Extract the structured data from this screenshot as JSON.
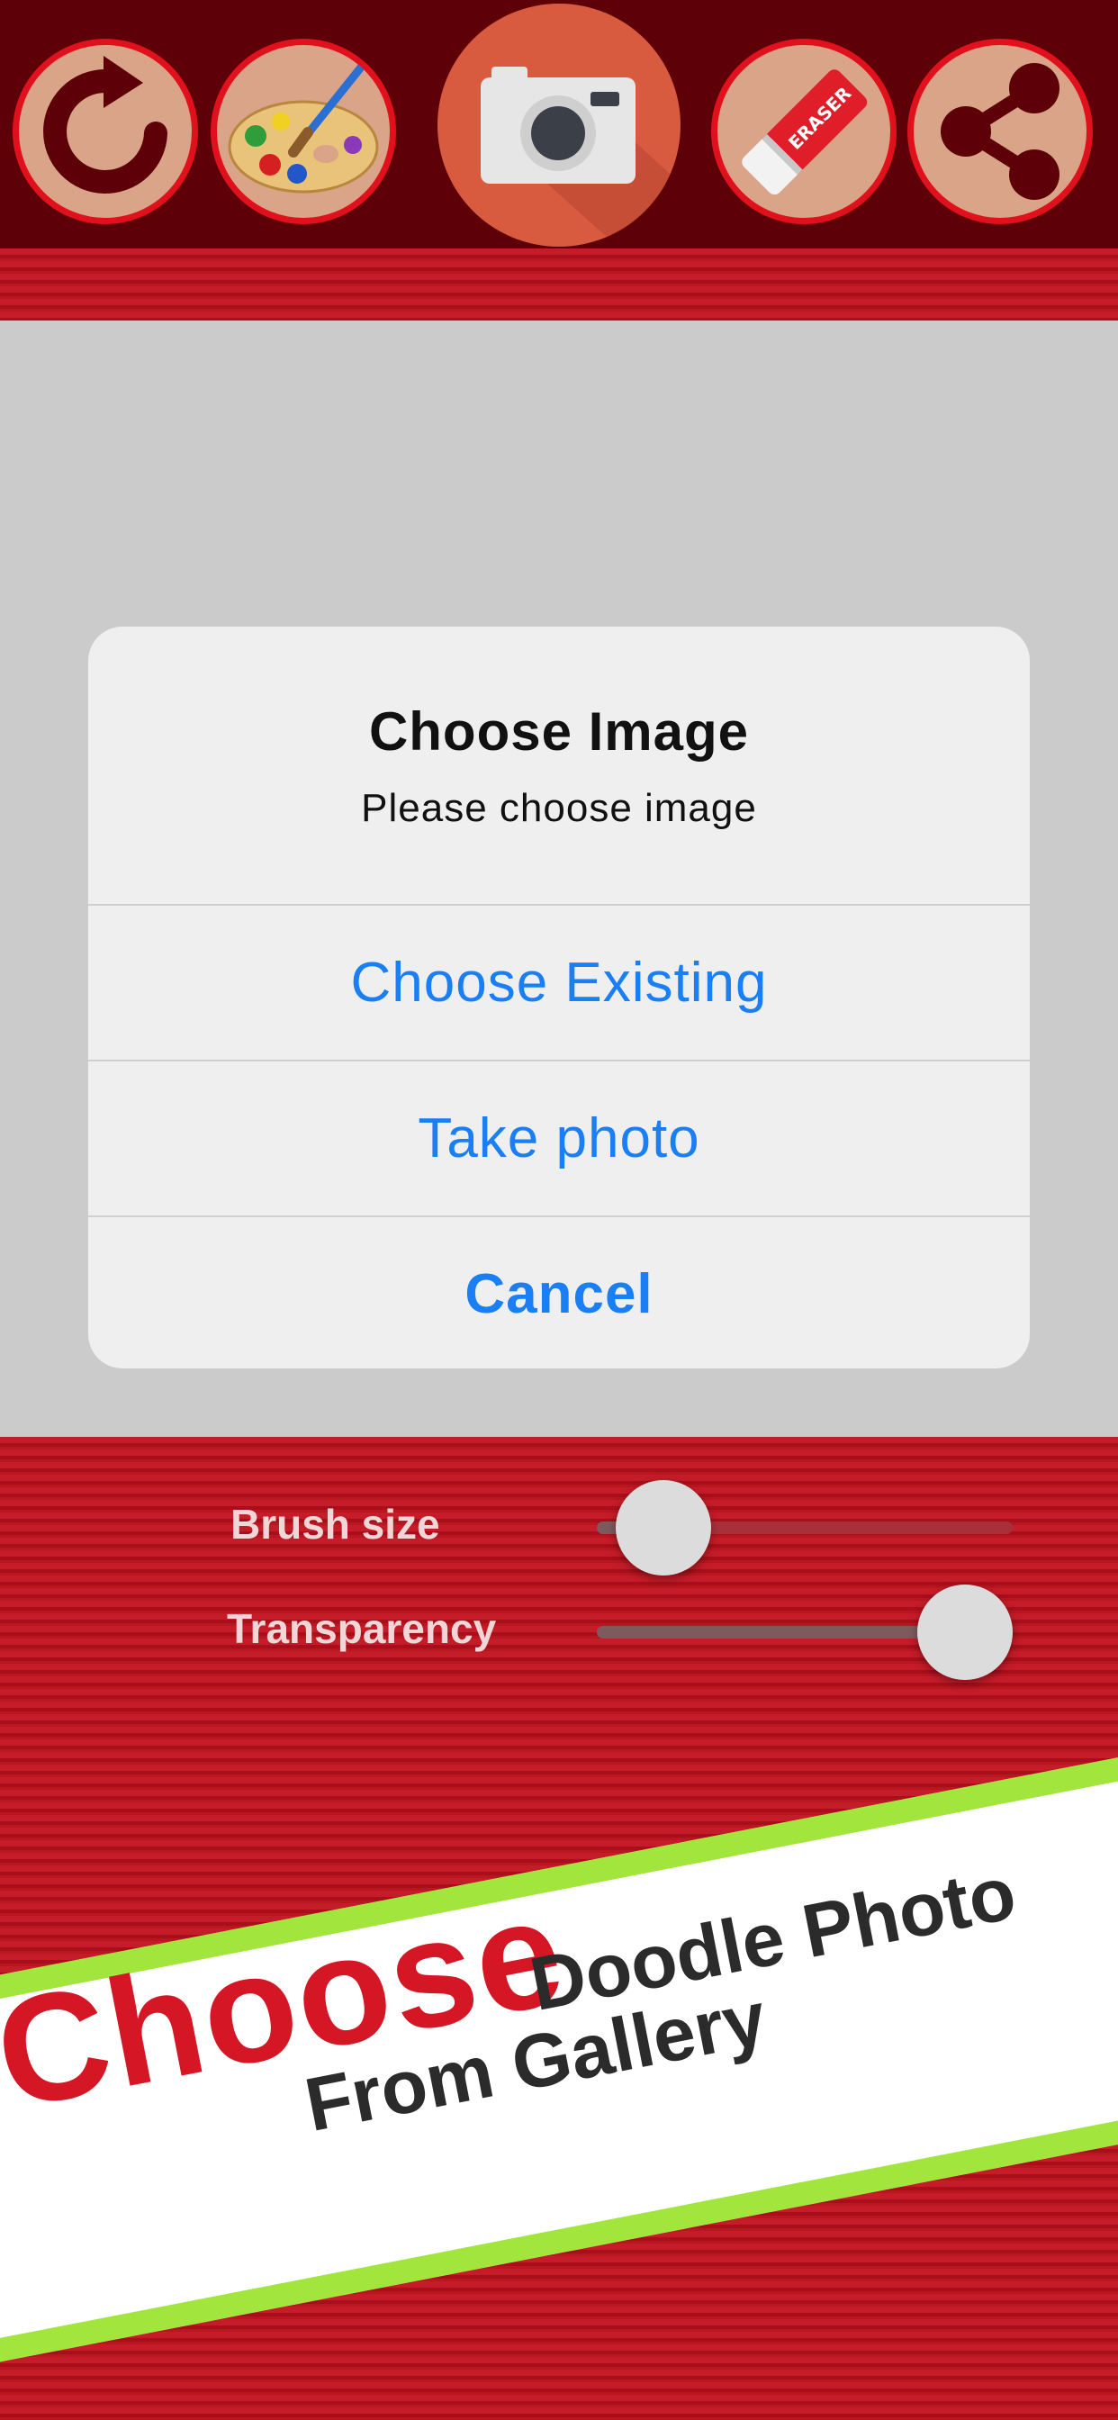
{
  "toolbar": {
    "buttons": [
      {
        "icon": "redo-icon"
      },
      {
        "icon": "palette-icon"
      },
      {
        "icon": "camera-icon"
      },
      {
        "icon": "eraser-icon",
        "label": "ERASER"
      },
      {
        "icon": "share-icon"
      }
    ]
  },
  "dialog": {
    "title": "Choose Image",
    "message": "Please choose image",
    "options": [
      "Choose Existing",
      "Take photo"
    ],
    "cancel_label": "Cancel"
  },
  "controls": {
    "brush_size": {
      "label": "Brush size",
      "value": 0.18
    },
    "transparency": {
      "label": "Transparency",
      "value": 1.0
    }
  },
  "banner": {
    "highlight": "Choose",
    "line1": "Doodle Photo",
    "line2": "From Gallery"
  },
  "colors": {
    "toolbar_bg": "#5e0008",
    "accent_red": "#d41625",
    "link_blue": "#1a7ef5",
    "banner_green": "#a2e53c"
  }
}
